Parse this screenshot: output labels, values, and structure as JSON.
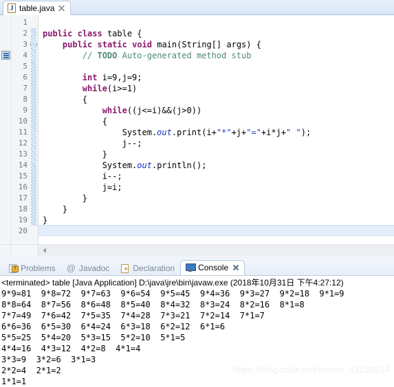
{
  "editor": {
    "tab": {
      "icon": "java-file-icon",
      "label": "table.java",
      "close": "close-icon"
    },
    "lines": [
      {
        "num": "1",
        "tokens": []
      },
      {
        "num": "2",
        "tokens": [
          {
            "t": "kw",
            "v": "public"
          },
          {
            "t": "plain",
            "v": " "
          },
          {
            "t": "kw",
            "v": "class"
          },
          {
            "t": "plain",
            "v": " table {"
          }
        ]
      },
      {
        "num": "3",
        "fold": true,
        "tokens": [
          {
            "t": "plain",
            "v": "    "
          },
          {
            "t": "kw",
            "v": "public"
          },
          {
            "t": "plain",
            "v": " "
          },
          {
            "t": "kw",
            "v": "static"
          },
          {
            "t": "plain",
            "v": " "
          },
          {
            "t": "kw",
            "v": "void"
          },
          {
            "t": "plain",
            "v": " main(String[] args) {"
          }
        ]
      },
      {
        "num": "4",
        "marker": true,
        "tokens": [
          {
            "t": "cmt",
            "v": "        // "
          },
          {
            "t": "todo",
            "v": "TODO"
          },
          {
            "t": "cmt",
            "v": " Auto-generated method stub"
          }
        ]
      },
      {
        "num": "5",
        "tokens": []
      },
      {
        "num": "6",
        "tokens": [
          {
            "t": "plain",
            "v": "        "
          },
          {
            "t": "kw",
            "v": "int"
          },
          {
            "t": "plain",
            "v": " i=9,j=9;"
          }
        ]
      },
      {
        "num": "7",
        "tokens": [
          {
            "t": "plain",
            "v": "        "
          },
          {
            "t": "kw",
            "v": "while"
          },
          {
            "t": "plain",
            "v": "(i>=1)"
          }
        ]
      },
      {
        "num": "8",
        "tokens": [
          {
            "t": "plain",
            "v": "        {"
          }
        ]
      },
      {
        "num": "9",
        "tokens": [
          {
            "t": "plain",
            "v": "            "
          },
          {
            "t": "kw",
            "v": "while"
          },
          {
            "t": "plain",
            "v": "((j<=i)&&(j>0))"
          }
        ]
      },
      {
        "num": "10",
        "tokens": [
          {
            "t": "plain",
            "v": "            {"
          }
        ]
      },
      {
        "num": "11",
        "tokens": [
          {
            "t": "plain",
            "v": "                System."
          },
          {
            "t": "fld",
            "v": "out"
          },
          {
            "t": "plain",
            "v": ".print(i+"
          },
          {
            "t": "str",
            "v": "\"*\""
          },
          {
            "t": "plain",
            "v": "+j+"
          },
          {
            "t": "str",
            "v": "\"=\""
          },
          {
            "t": "plain",
            "v": "+i*j+"
          },
          {
            "t": "str",
            "v": "\" \""
          },
          {
            "t": "plain",
            "v": ");"
          }
        ]
      },
      {
        "num": "12",
        "tokens": [
          {
            "t": "plain",
            "v": "                j--;"
          }
        ]
      },
      {
        "num": "13",
        "tokens": [
          {
            "t": "plain",
            "v": "            }"
          }
        ]
      },
      {
        "num": "14",
        "tokens": [
          {
            "t": "plain",
            "v": "            System."
          },
          {
            "t": "fld",
            "v": "out"
          },
          {
            "t": "plain",
            "v": ".println();"
          }
        ]
      },
      {
        "num": "15",
        "tokens": [
          {
            "t": "plain",
            "v": "            i--;"
          }
        ]
      },
      {
        "num": "16",
        "tokens": [
          {
            "t": "plain",
            "v": "            j=i;"
          }
        ]
      },
      {
        "num": "17",
        "tokens": [
          {
            "t": "plain",
            "v": "        }"
          }
        ]
      },
      {
        "num": "18",
        "tokens": [
          {
            "t": "plain",
            "v": "    }"
          }
        ]
      },
      {
        "num": "19",
        "tokens": [
          {
            "t": "plain",
            "v": "}"
          }
        ]
      },
      {
        "num": "20",
        "current": true,
        "tokens": []
      }
    ]
  },
  "bottom_panel": {
    "tabs": [
      {
        "icon": "problems-icon",
        "label": "Problems",
        "active": false,
        "closeable": false
      },
      {
        "icon": "javadoc-icon",
        "label": "Javadoc",
        "active": false,
        "closeable": false
      },
      {
        "icon": "declaration-icon",
        "label": "Declaration",
        "active": false,
        "closeable": false
      },
      {
        "icon": "console-icon",
        "label": "Console",
        "active": true,
        "closeable": true
      }
    ],
    "console": {
      "header": "<terminated> table [Java Application] D:\\java\\jre\\bin\\javaw.exe (2018年10月31日 下午4:27:12)",
      "output": [
        "9*9=81  9*8=72  9*7=63  9*6=54  9*5=45  9*4=36  9*3=27  9*2=18  9*1=9",
        "8*8=64  8*7=56  8*6=48  8*5=40  8*4=32  8*3=24  8*2=16  8*1=8",
        "7*7=49  7*6=42  7*5=35  7*4=28  7*3=21  7*2=14  7*1=7",
        "6*6=36  6*5=30  6*4=24  6*3=18  6*2=12  6*1=6",
        "5*5=25  5*4=20  5*3=15  5*2=10  5*1=5",
        "4*4=16  4*3=12  4*2=8  4*1=4",
        "3*3=9  3*2=6  3*1=3",
        "2*2=4  2*1=2",
        "1*1=1"
      ]
    }
  },
  "watermark": "https://blog.csdn.net/weixin_43133824",
  "colors": {
    "keyword": "#8a1a6b",
    "comment": "#4e8a78",
    "string": "#1f3fc0",
    "field": "#1435bb",
    "current_line": "#e4eefb",
    "tabbar": "#d8e6f6"
  }
}
